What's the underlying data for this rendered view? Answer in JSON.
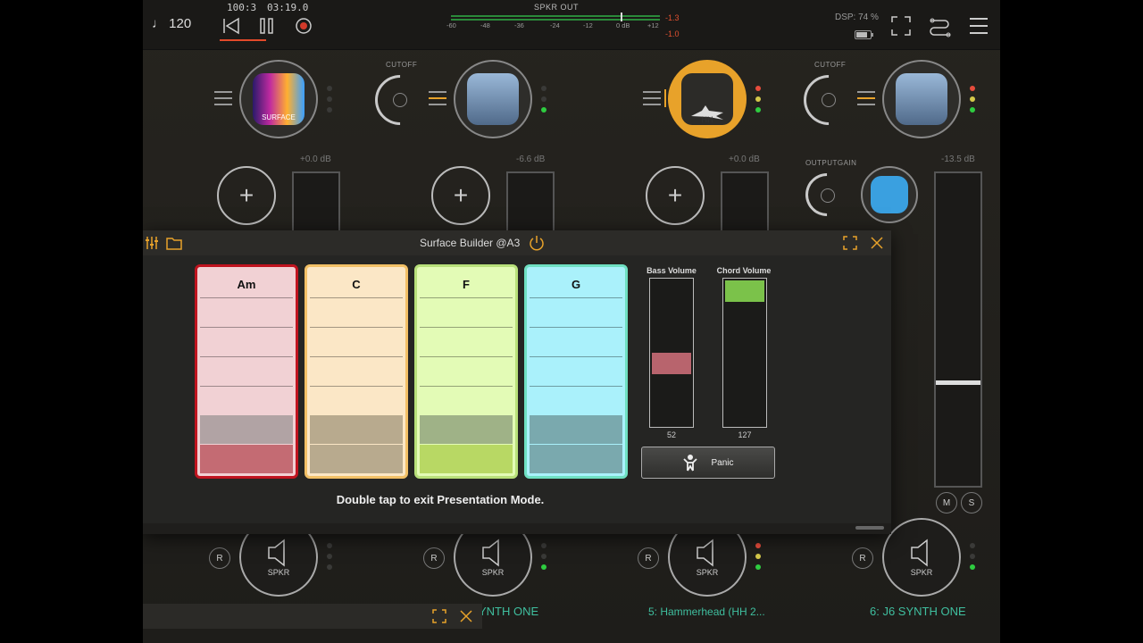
{
  "transport": {
    "tempo": "♩ 120",
    "bar_position": "100:3",
    "time": "03:19.0"
  },
  "meter": {
    "title": "SPKR OUT",
    "scale": [
      "-60",
      "-48",
      "-36",
      "-24",
      "-12",
      "0 dB",
      "+12"
    ],
    "peak_top": "-1.3",
    "peak_bottom": "-1.0"
  },
  "dsp": "DSP: 74 %",
  "strips": [
    {
      "plugin_label": "SURFACE",
      "gain": "+0.0 dB",
      "output": "SPKR",
      "knob_label": ""
    },
    {
      "plugin_label": "",
      "gain": "-6.6 dB",
      "output": "SPKR",
      "knob_label": "CUTOFF",
      "track_name": "YNTH ONE"
    },
    {
      "plugin_label": "HH",
      "gain": "+0.0 dB",
      "output": "SPKR",
      "knob_label": "",
      "track_name": "5: Hammerhead (HH 2..."
    },
    {
      "plugin_label": "",
      "gain": "-13.5 dB",
      "output": "SPKR",
      "knob_label": "CUTOFF",
      "knob2_label": "OUTPUTGAIN",
      "track_name": "6: J6 SYNTH ONE"
    }
  ],
  "record_label": "R",
  "mute_label": "M",
  "solo_label": "S",
  "surface_builder": {
    "title": "Surface Builder @A3",
    "pads": [
      {
        "label": "Am",
        "border": "#c0141f",
        "fill": "#f1d1d4",
        "dark": "#b1a3a4",
        "active": "#c46b73"
      },
      {
        "label": "C",
        "border": "#f2c066",
        "fill": "#fbe7c6",
        "dark": "#b8aa8e",
        "active": "#b8aa8e"
      },
      {
        "label": "F",
        "border": "#b8e07a",
        "fill": "#e3fbb6",
        "dark": "#9fb287",
        "active": "#b8d864"
      },
      {
        "label": "G",
        "border": "#6fe0c2",
        "fill": "#aaf1fb",
        "dark": "#7aa9ae",
        "active": "#7aa9ae"
      }
    ],
    "bass_volume": {
      "label": "Bass Volume",
      "value": "52",
      "level": 0.41,
      "color": "#b8646d"
    },
    "chord_volume": {
      "label": "Chord Volume",
      "value": "127",
      "level": 1.0,
      "color": "#7bc24a"
    },
    "panic_label": "Panic",
    "hint": "Double tap to exit Presentation Mode."
  },
  "colors": {
    "accent": "#e8a22a",
    "track_name": "#3fbf9f",
    "led_green": "#2ecc40",
    "led_red": "#e74c3c",
    "led_yellow": "#d4c84a"
  }
}
